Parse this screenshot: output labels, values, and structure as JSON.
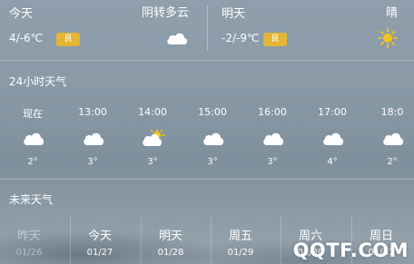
{
  "today": {
    "label": "今天",
    "condition": "阴转多云",
    "temp": "4/-6℃",
    "aqi": "良",
    "icon": "cloud-icon"
  },
  "tomorrow": {
    "label": "明天",
    "condition": "晴",
    "temp": "-2/-9℃",
    "aqi": "良",
    "icon": "sun-icon"
  },
  "hourly": {
    "title": "24小时天气",
    "items": [
      {
        "time": "现在",
        "temp": "2°",
        "icon": "cloud-icon"
      },
      {
        "time": "13:00",
        "temp": "3°",
        "icon": "cloud-icon"
      },
      {
        "time": "14:00",
        "temp": "3°",
        "icon": "partly-cloudy-icon"
      },
      {
        "time": "15:00",
        "temp": "3°",
        "icon": "cloud-icon"
      },
      {
        "time": "16:00",
        "temp": "3°",
        "icon": "cloud-icon"
      },
      {
        "time": "17:00",
        "temp": "4°",
        "icon": "cloud-icon"
      },
      {
        "time": "18:0",
        "temp": "2°",
        "icon": "cloud-icon"
      }
    ]
  },
  "forecast": {
    "title": "未来天气",
    "days": [
      {
        "name": "昨天",
        "date": "01/26"
      },
      {
        "name": "今天",
        "date": "01/27"
      },
      {
        "name": "明天",
        "date": "01/28"
      },
      {
        "name": "周五",
        "date": "01/29"
      },
      {
        "name": "周六",
        "date": "01/30"
      },
      {
        "name": "周日",
        "date": "01/31"
      }
    ]
  },
  "watermark": "QQTF.COM",
  "colors": {
    "aqi_badge": "#e4b635",
    "sun": "#f5c518"
  }
}
